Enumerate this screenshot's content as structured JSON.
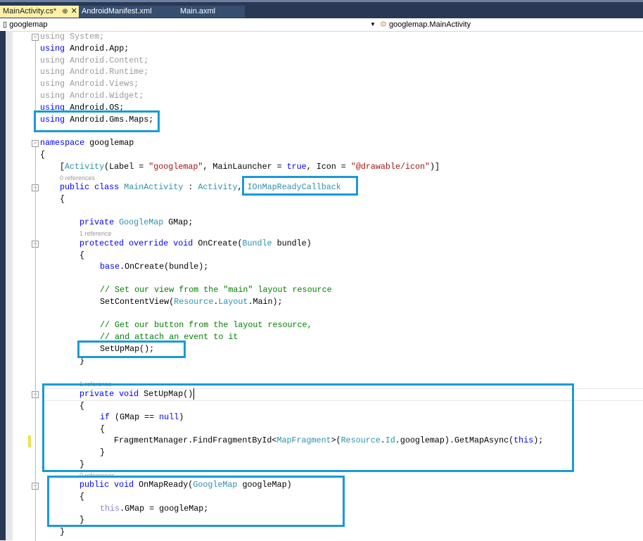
{
  "tabs": [
    {
      "label": "MainActivity.cs*",
      "active": true
    },
    {
      "label": "AndroidManifest.xml"
    },
    {
      "label": "Main.axml"
    }
  ],
  "tab_pin": "⊕",
  "tab_close": "✕",
  "nav": {
    "project": "googlemap",
    "class": "googlemap.MainActivity"
  },
  "code": [
    [
      [
        "using System;",
        "dim"
      ]
    ],
    [
      [
        "using",
        "kw"
      ],
      [
        " Android.App;",
        ""
      ]
    ],
    [
      [
        "using Android.Content;",
        "dim"
      ]
    ],
    [
      [
        "using Android.Runtime;",
        "dim"
      ]
    ],
    [
      [
        "using Android.Views;",
        "dim"
      ]
    ],
    [
      [
        "using Android.Widget;",
        "dim"
      ]
    ],
    [
      [
        "using",
        "kw"
      ],
      [
        " Android.OS;",
        ""
      ]
    ],
    [
      [
        "using",
        "kw"
      ],
      [
        " Android.Gms.Maps;",
        ""
      ]
    ],
    [
      [
        "namespace",
        "kw"
      ],
      [
        " googlemap",
        ""
      ]
    ],
    [
      [
        "{",
        ""
      ]
    ],
    [
      [
        "[",
        ""
      ],
      [
        "Activity",
        "ty"
      ],
      [
        "(Label = ",
        ""
      ],
      [
        "\"googlemap\"",
        "st"
      ],
      [
        ", MainLauncher = ",
        ""
      ],
      [
        "true",
        "kw"
      ],
      [
        ", Icon = ",
        ""
      ],
      [
        "\"@drawable/icon\"",
        "st"
      ],
      [
        ")]",
        ""
      ]
    ],
    [
      [
        "public class",
        "kw"
      ],
      [
        " ",
        ""
      ],
      [
        "MainActivity",
        "ty"
      ],
      [
        " : ",
        ""
      ],
      [
        "Activity",
        "ty"
      ],
      [
        ", ",
        ""
      ],
      [
        "IOnMapReadyCallback",
        "ty"
      ]
    ],
    [
      [
        "{",
        ""
      ]
    ],
    [
      [
        "private",
        "kw"
      ],
      [
        " ",
        ""
      ],
      [
        "GoogleMap",
        "ty"
      ],
      [
        " GMap;",
        ""
      ]
    ],
    [
      [
        "protected override void",
        "kw"
      ],
      [
        " OnCreate(",
        ""
      ],
      [
        "Bundle",
        "ty"
      ],
      [
        " bundle)",
        ""
      ]
    ],
    [
      [
        "{",
        ""
      ]
    ],
    [
      [
        "base",
        "kw"
      ],
      [
        ".OnCreate(bundle);",
        ""
      ]
    ],
    [
      [
        "// Set our view from the \"main\" layout resource",
        "cm"
      ]
    ],
    [
      [
        "SetContentView(",
        ""
      ],
      [
        "Resource",
        "ty"
      ],
      [
        ".",
        ""
      ],
      [
        "Layout",
        "ty"
      ],
      [
        ".Main);",
        ""
      ]
    ],
    [
      [
        "// Get our button from the layout resource,",
        "cm"
      ]
    ],
    [
      [
        "// and attach an event to it",
        "cm"
      ]
    ],
    [
      [
        "SetUpMap();",
        ""
      ]
    ],
    [
      [
        "}",
        ""
      ]
    ],
    [
      [
        "private void",
        "kw"
      ],
      [
        " SetUpMap()",
        ""
      ]
    ],
    [
      [
        "{",
        ""
      ]
    ],
    [
      [
        "if",
        "kw"
      ],
      [
        " (GMap == ",
        ""
      ],
      [
        "null",
        "kw"
      ],
      [
        ")",
        ""
      ]
    ],
    [
      [
        "{",
        ""
      ]
    ],
    [
      [
        "FragmentManager.FindFragmentById<",
        ""
      ],
      [
        "MapFragment",
        "ty"
      ],
      [
        ">(",
        ""
      ],
      [
        "Resource",
        "ty"
      ],
      [
        ".",
        ""
      ],
      [
        "Id",
        "ty"
      ],
      [
        ".googlemap).GetMapAsync(",
        ""
      ],
      [
        "this",
        "kw"
      ],
      [
        ");",
        ""
      ]
    ],
    [
      [
        "}",
        ""
      ]
    ],
    [
      [
        "}",
        ""
      ]
    ],
    [
      [
        "public void",
        "kw"
      ],
      [
        " OnMapReady(",
        ""
      ],
      [
        "GoogleMap",
        "ty"
      ],
      [
        " googleMap)",
        ""
      ]
    ],
    [
      [
        "{",
        ""
      ]
    ],
    [
      [
        "this",
        "dimkw"
      ],
      [
        ".GMap = googleMap;",
        ""
      ]
    ],
    [
      [
        "}",
        ""
      ]
    ],
    [
      [
        "}",
        ""
      ]
    ]
  ],
  "lenses": [
    "0 references",
    "1 reference",
    "1 reference",
    "0 references"
  ]
}
